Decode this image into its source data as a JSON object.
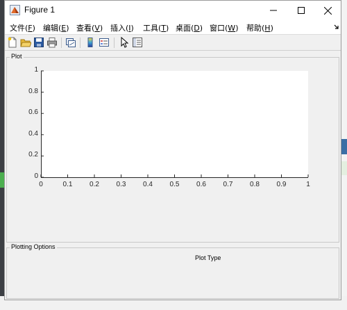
{
  "window": {
    "title": "Figure 1"
  },
  "menu": [
    {
      "name": "file",
      "pre": "文件(",
      "key": "F",
      "post": ")"
    },
    {
      "name": "edit",
      "pre": "编辑(",
      "key": "E",
      "post": ")"
    },
    {
      "name": "view",
      "pre": "查看(",
      "key": "V",
      "post": ")"
    },
    {
      "name": "insert",
      "pre": "插入(",
      "key": "I",
      "post": ")"
    },
    {
      "name": "tools",
      "pre": "工具(",
      "key": "T",
      "post": ")"
    },
    {
      "name": "desktop",
      "pre": "桌面(",
      "key": "D",
      "post": ")"
    },
    {
      "name": "window",
      "pre": "窗口(",
      "key": "W",
      "post": ")"
    },
    {
      "name": "help",
      "pre": "帮助(",
      "key": "H",
      "post": ")"
    }
  ],
  "toolbar": {
    "icons": [
      "new-file-icon",
      "open-folder-icon",
      "save-icon",
      "print-icon",
      "link-plot-icon",
      "colorbar-icon",
      "legend-icon",
      "pointer-icon",
      "property-editor-icon"
    ]
  },
  "plot_panel": {
    "title": "Plot"
  },
  "options_panel": {
    "title": "Plotting Options",
    "plot_type_label": "Plot Type"
  },
  "chart_data": {
    "type": "line",
    "series": [],
    "xlim": [
      0,
      1
    ],
    "ylim": [
      0,
      1
    ],
    "xticks": [
      "0",
      "0.1",
      "0.2",
      "0.3",
      "0.4",
      "0.5",
      "0.6",
      "0.7",
      "0.8",
      "0.9",
      "1"
    ],
    "yticks": [
      "0",
      "0.2",
      "0.4",
      "0.6",
      "0.8",
      "1"
    ],
    "grid": false
  },
  "colors": {
    "axes_bg": "#ffffff",
    "figure_bg": "#f0f0f0",
    "axis": "#262626"
  }
}
